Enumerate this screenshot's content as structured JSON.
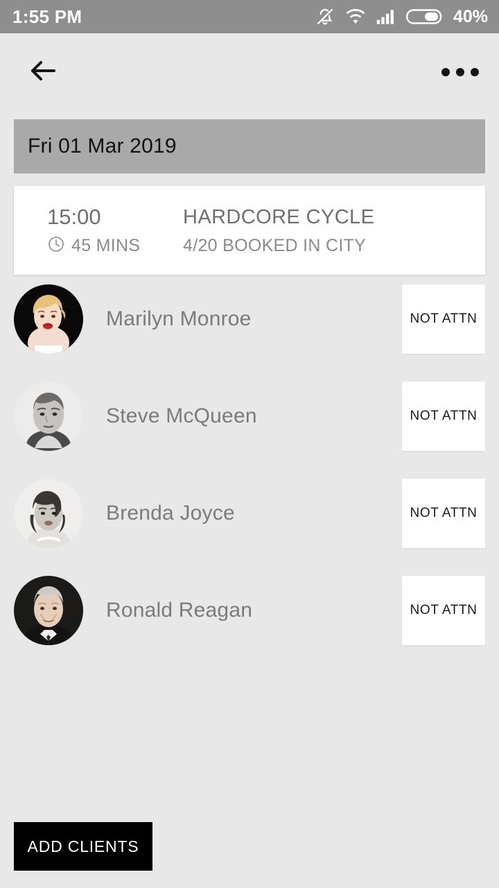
{
  "status_bar": {
    "time": "1:55 PM",
    "battery_percent": "40%",
    "icons": [
      "bell-mute-icon",
      "wifi-icon",
      "signal-icon",
      "battery-icon"
    ]
  },
  "app_bar": {
    "back_icon": "back-arrow-icon",
    "overflow_icon": "more-options-icon"
  },
  "date_header": {
    "label": "Fri 01 Mar 2019",
    "background": "#a9a9a9"
  },
  "class_card": {
    "time": "15:00",
    "duration": "45 MINS",
    "duration_icon": "clock-icon",
    "title": "HARDCORE CYCLE",
    "booking": "4/20 BOOKED IN CITY"
  },
  "clients": [
    {
      "name": "Marilyn Monroe",
      "status_label": "NOT ATTN"
    },
    {
      "name": "Steve McQueen",
      "status_label": "NOT ATTN"
    },
    {
      "name": "Brenda Joyce",
      "status_label": "NOT ATTN"
    },
    {
      "name": "Ronald Reagan",
      "status_label": "NOT ATTN"
    }
  ],
  "bottom_action": {
    "label": "ADD CLIENTS",
    "background": "#000000",
    "text_color": "#ffffff"
  }
}
